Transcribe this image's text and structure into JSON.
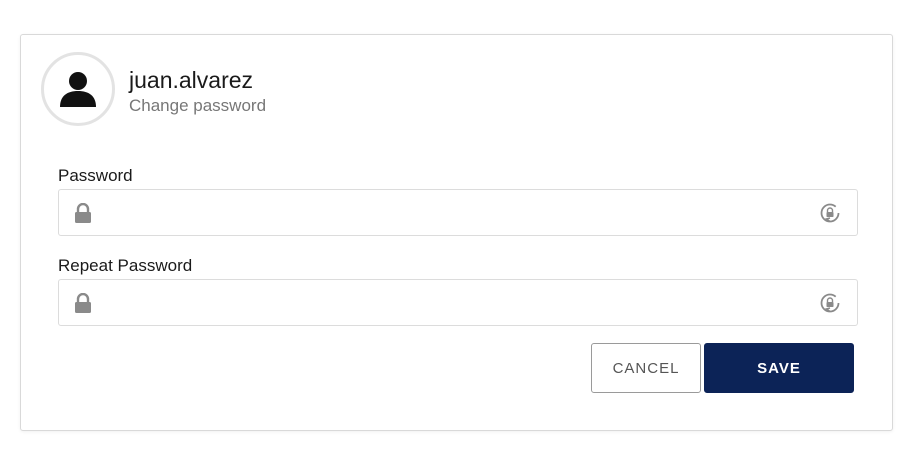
{
  "profile": {
    "username": "juan.alvarez",
    "subtitle": "Change password",
    "avatar_icon": "user-silhouette-icon"
  },
  "form": {
    "password": {
      "label": "Password",
      "value": "",
      "placeholder": "",
      "left_icon": "lock-icon",
      "right_icon": "reveal-password-icon"
    },
    "repeat_password": {
      "label": "Repeat Password",
      "value": "",
      "placeholder": "",
      "left_icon": "lock-icon",
      "right_icon": "reveal-password-icon"
    }
  },
  "actions": {
    "cancel_label": "CANCEL",
    "save_label": "SAVE"
  },
  "colors": {
    "primary": "#0c2357",
    "icon_gray": "#8a8a8a",
    "border": "#dcdcdc"
  }
}
